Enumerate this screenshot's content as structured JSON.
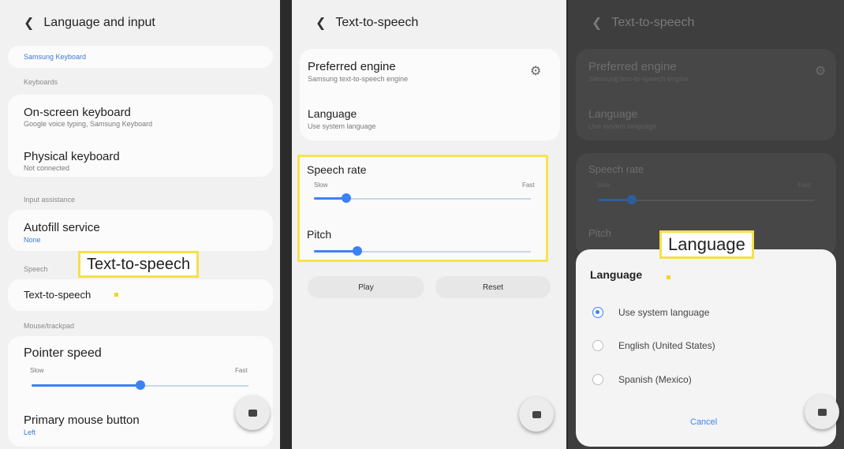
{
  "panel1": {
    "header": "Language and input",
    "samsung_keyboard": "Samsung Keyboard",
    "keyboards_cat": "Keyboards",
    "onscreen_title": "On-screen keyboard",
    "onscreen_sub": "Google voice typing, Samsung Keyboard",
    "physical_title": "Physical keyboard",
    "physical_sub": "Not connected",
    "input_assist_cat": "Input assistance",
    "autofill_title": "Autofill service",
    "autofill_sub": "None",
    "speech_cat": "Speech",
    "tts_title": "Text-to-speech",
    "mouse_cat": "Mouse/trackpad",
    "pointer_title": "Pointer speed",
    "pointer_slow": "Slow",
    "pointer_fast": "Fast",
    "pointer_speed_value": 0.5,
    "primary_title": "Primary mouse button",
    "primary_sub": "Left",
    "callout": "Text-to-speech"
  },
  "panel2": {
    "header": "Text-to-speech",
    "engine_title": "Preferred engine",
    "engine_sub": "Samsung text-to-speech engine",
    "language_title": "Language",
    "language_sub": "Use system language",
    "rate_title": "Speech rate",
    "rate_slow": "Slow",
    "rate_fast": "Fast",
    "rate_value": 0.15,
    "pitch_title": "Pitch",
    "pitch_value": 0.2,
    "play_label": "Play",
    "reset_label": "Reset"
  },
  "panel3": {
    "header": "Text-to-speech",
    "engine_title": "Preferred engine",
    "engine_sub": "Samsung text-to-speech engine",
    "language_title": "Language",
    "language_sub": "Use system language",
    "rate_title": "Speech rate",
    "rate_slow": "Slow",
    "rate_fast": "Fast",
    "pitch_title": "Pitch",
    "callout": "Language",
    "dialog_title": "Language",
    "options": [
      "Use system language",
      "English (United States)",
      "Spanish (Mexico)"
    ],
    "selected_index": 0,
    "cancel_label": "Cancel"
  },
  "colors": {
    "accent": "#3b82f6",
    "highlight": "#f5e04a"
  },
  "icons": {
    "back": "chevron-left-icon",
    "settings": "gear-icon",
    "floating": "stop-square-icon"
  }
}
